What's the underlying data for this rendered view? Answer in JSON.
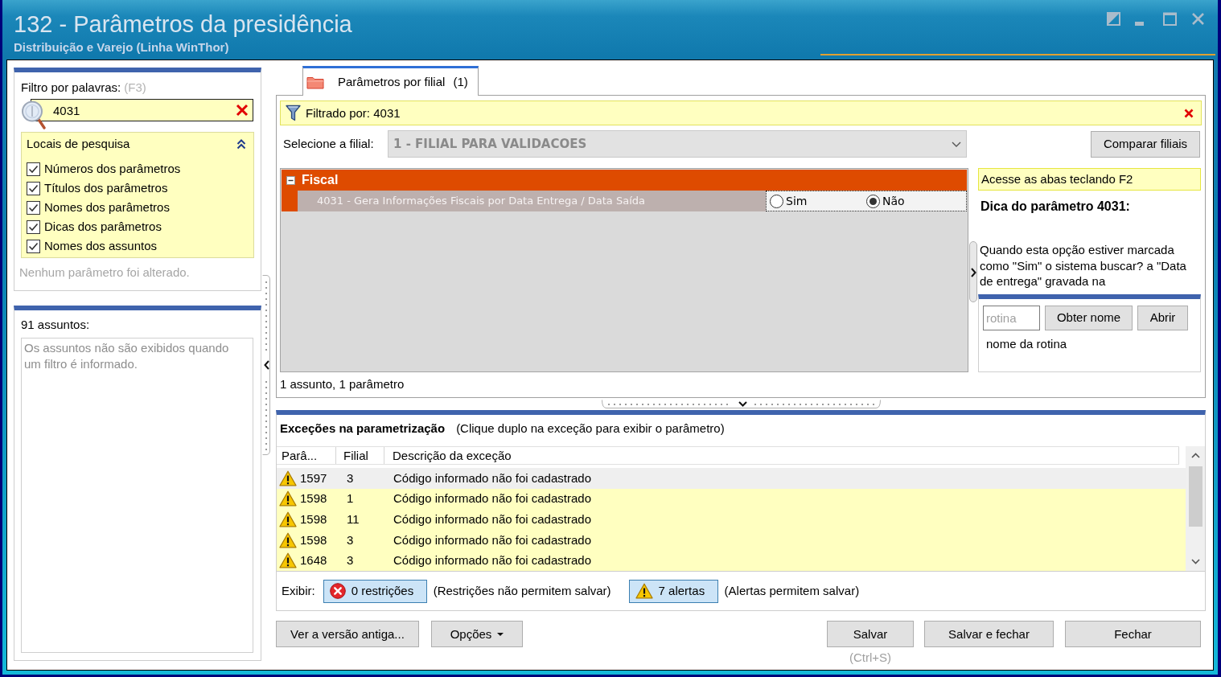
{
  "window": {
    "title": "132 - Parâmetros da presidência",
    "subtitle": "Distribuição e Varejo (Linha WinThor)"
  },
  "filter_panel": {
    "label": "Filtro por palavras:",
    "shortcut": "(F3)",
    "search": {
      "value": "4031"
    },
    "search_places": {
      "title": "Locais de pesquisa",
      "expanded": true,
      "options": [
        {
          "label": "Números dos parâmetros",
          "checked": true
        },
        {
          "label": "Títulos dos parâmetros",
          "checked": true
        },
        {
          "label": "Nomes dos parâmetros",
          "checked": true
        },
        {
          "label": "Dicas dos parâmetros",
          "checked": true
        },
        {
          "label": "Nomes dos assuntos",
          "checked": true
        }
      ]
    },
    "status": "Nenhum parâmetro foi alterado."
  },
  "subjects_panel": {
    "count": "91 assuntos:",
    "message": "Os assuntos não são exibidos quando um filtro é informado."
  },
  "tabs": [
    {
      "label": "Parâmetros por filial",
      "count": "(1)",
      "selected": true
    }
  ],
  "filter_bar": {
    "text": "Filtrado por: 4031"
  },
  "branch": {
    "label": "Selecione a filial:",
    "value": "1 - FILIAL PARA VALIDACOES",
    "disabled": true
  },
  "compare_button": {
    "label": "Comparar filiais"
  },
  "parameter_grid": {
    "groups": [
      {
        "name": "Fiscal",
        "expanded": true,
        "parameters": [
          {
            "label": "4031 - Gera Informações Fiscais por Data Entrega / Data Saída",
            "options": [
              {
                "label": "Sim",
                "selected": false
              },
              {
                "label": "Não",
                "selected": true
              }
            ]
          }
        ]
      }
    ]
  },
  "summary": "1 assunto, 1 parâmetro",
  "hint_panel": {
    "banner": "Acesse as abas teclando F2",
    "title": "Dica do parâmetro 4031:",
    "text": "Quando esta opção estiver marcada como \"Sim\" o sistema buscar? a \"Data de entrega\" gravada na"
  },
  "routine": {
    "placeholder": "rotina",
    "buttons": [
      "Obter nome",
      "Abrir"
    ],
    "name": "nome da rotina"
  },
  "exceptions": {
    "title": "Exceções na parametrização",
    "hint": "(Clique duplo na exceção para exibir o parâmetro)",
    "columns": [
      "Parâ...",
      "Filial",
      "Descrição da exceção"
    ],
    "rows": [
      {
        "kind": "warning",
        "selected": true,
        "cells": [
          "1597",
          "3",
          "Código informado não foi cadastrado"
        ]
      },
      {
        "kind": "warning",
        "selected": false,
        "cells": [
          "1598",
          "1",
          "Código informado não foi cadastrado"
        ]
      },
      {
        "kind": "warning",
        "selected": false,
        "cells": [
          "1598",
          "11",
          "Código informado não foi cadastrado"
        ]
      },
      {
        "kind": "warning",
        "selected": false,
        "cells": [
          "1598",
          "3",
          "Código informado não foi cadastrado"
        ]
      },
      {
        "kind": "warning",
        "selected": false,
        "cells": [
          "1648",
          "3",
          "Código informado não foi cadastrado"
        ]
      }
    ]
  },
  "show_bar": {
    "label": "Exibir:",
    "filters": [
      {
        "kind": "error",
        "label": "0 restrições",
        "pressed": true,
        "note": "(Restrições não permitem salvar)"
      },
      {
        "kind": "warning",
        "label": "7 alertas",
        "pressed": true,
        "note": "(Alertas permitem salvar)"
      }
    ]
  },
  "buttons": {
    "left": [
      {
        "label": "Ver a versão antiga...",
        "kind": "plain"
      },
      {
        "label": "Opções",
        "kind": "dropdown"
      }
    ],
    "right": [
      {
        "label": "Salvar",
        "shortcut": "(Ctrl+S)"
      },
      {
        "label": "Salvar e fechar"
      },
      {
        "label": "Fechar"
      }
    ]
  }
}
